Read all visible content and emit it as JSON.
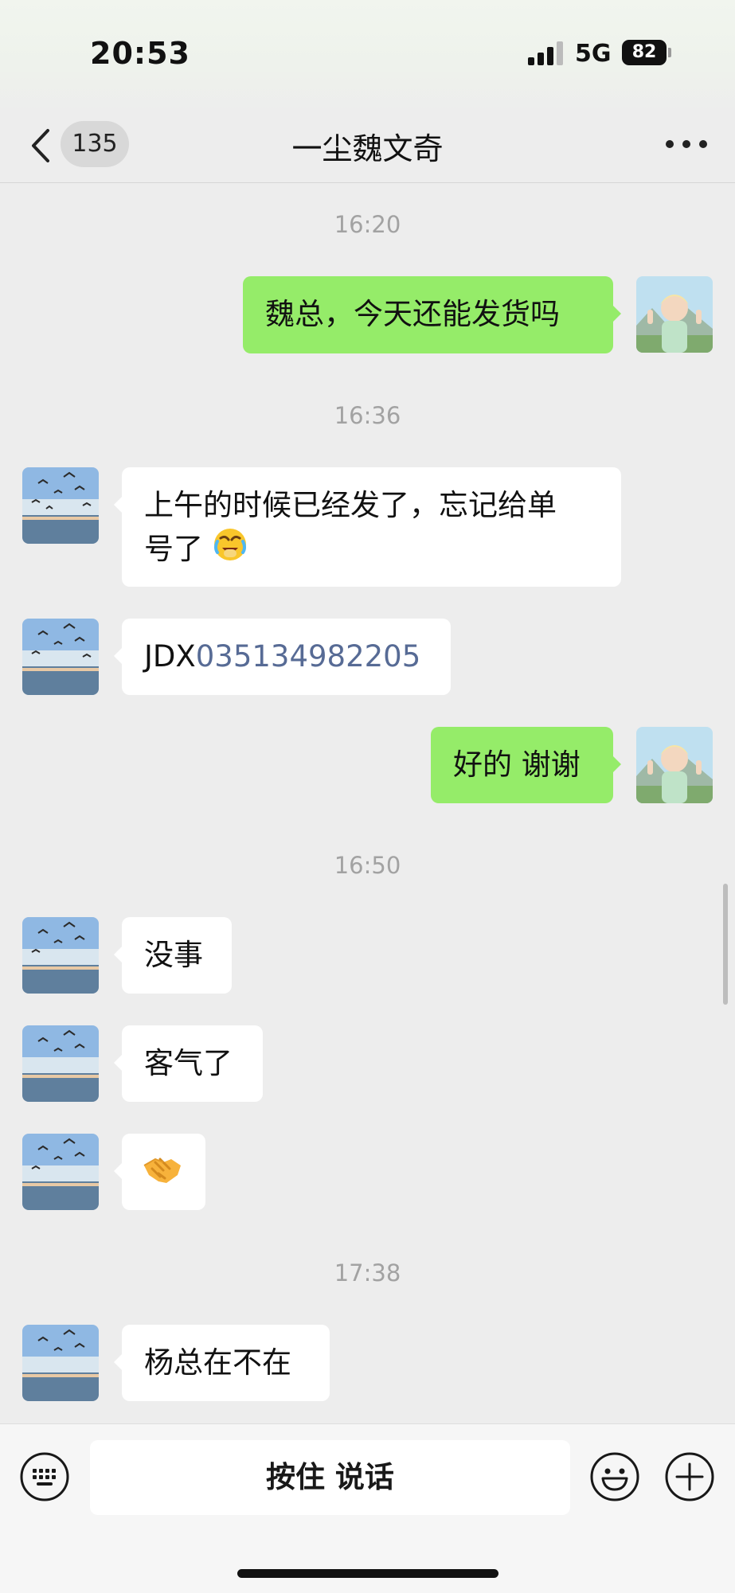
{
  "status_bar": {
    "time": "20:53",
    "network": "5G",
    "battery": "82"
  },
  "header": {
    "unread_count": "135",
    "title": "一尘魏文奇"
  },
  "messages": {
    "ts1": "16:20",
    "m1": "魏总，今天还能发货吗",
    "ts2": "16:36",
    "m2_line1": "上午的时候已经发了，忘记给单",
    "m2_line2": "号了",
    "m2_emoji": "face-with-tears-emoji",
    "m3_prefix": "JDX",
    "m3_number": "035134982205",
    "m4": "好的 谢谢",
    "ts3": "16:50",
    "m5": "没事",
    "m6": "客气了",
    "m7_emoji": "handshake-emoji",
    "ts4": "17:38",
    "m8": "杨总在不在"
  },
  "input_bar": {
    "hold_to_talk": "按住 说话"
  },
  "colors": {
    "sent_bubble": "#95ec69",
    "received_bubble": "#ffffff",
    "link": "#576b95",
    "background": "#ededed"
  }
}
